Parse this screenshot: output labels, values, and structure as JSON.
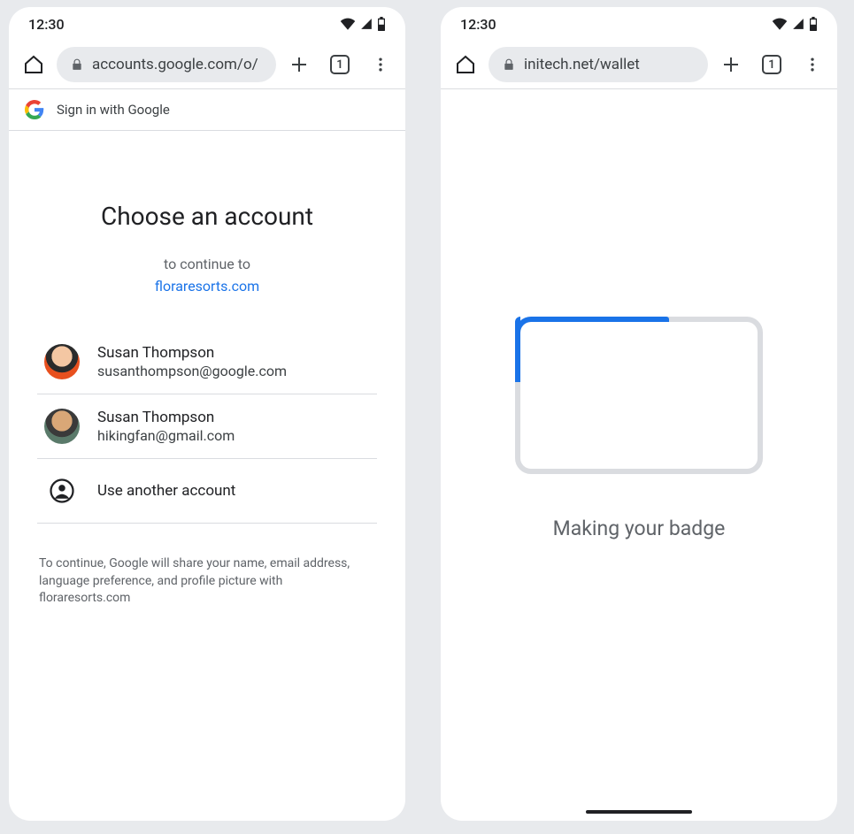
{
  "left": {
    "status_time": "12:30",
    "url": "accounts.google.com/o/",
    "tab_count": "1",
    "sign_in_header": "Sign in with Google",
    "title": "Choose an account",
    "continue_label": "to continue to",
    "continue_site": "floraresorts.com",
    "accounts": [
      {
        "name": "Susan Thompson",
        "email": "susanthompson@google.com"
      },
      {
        "name": "Susan Thompson",
        "email": "hikingfan@gmail.com"
      }
    ],
    "use_another": "Use another account",
    "disclosure": "To continue, Google will share your name, email address, language preference, and profile picture with floraresorts.com"
  },
  "right": {
    "status_time": "12:30",
    "url": "initech.net/wallet",
    "tab_count": "1",
    "making_text": "Making your badge"
  }
}
